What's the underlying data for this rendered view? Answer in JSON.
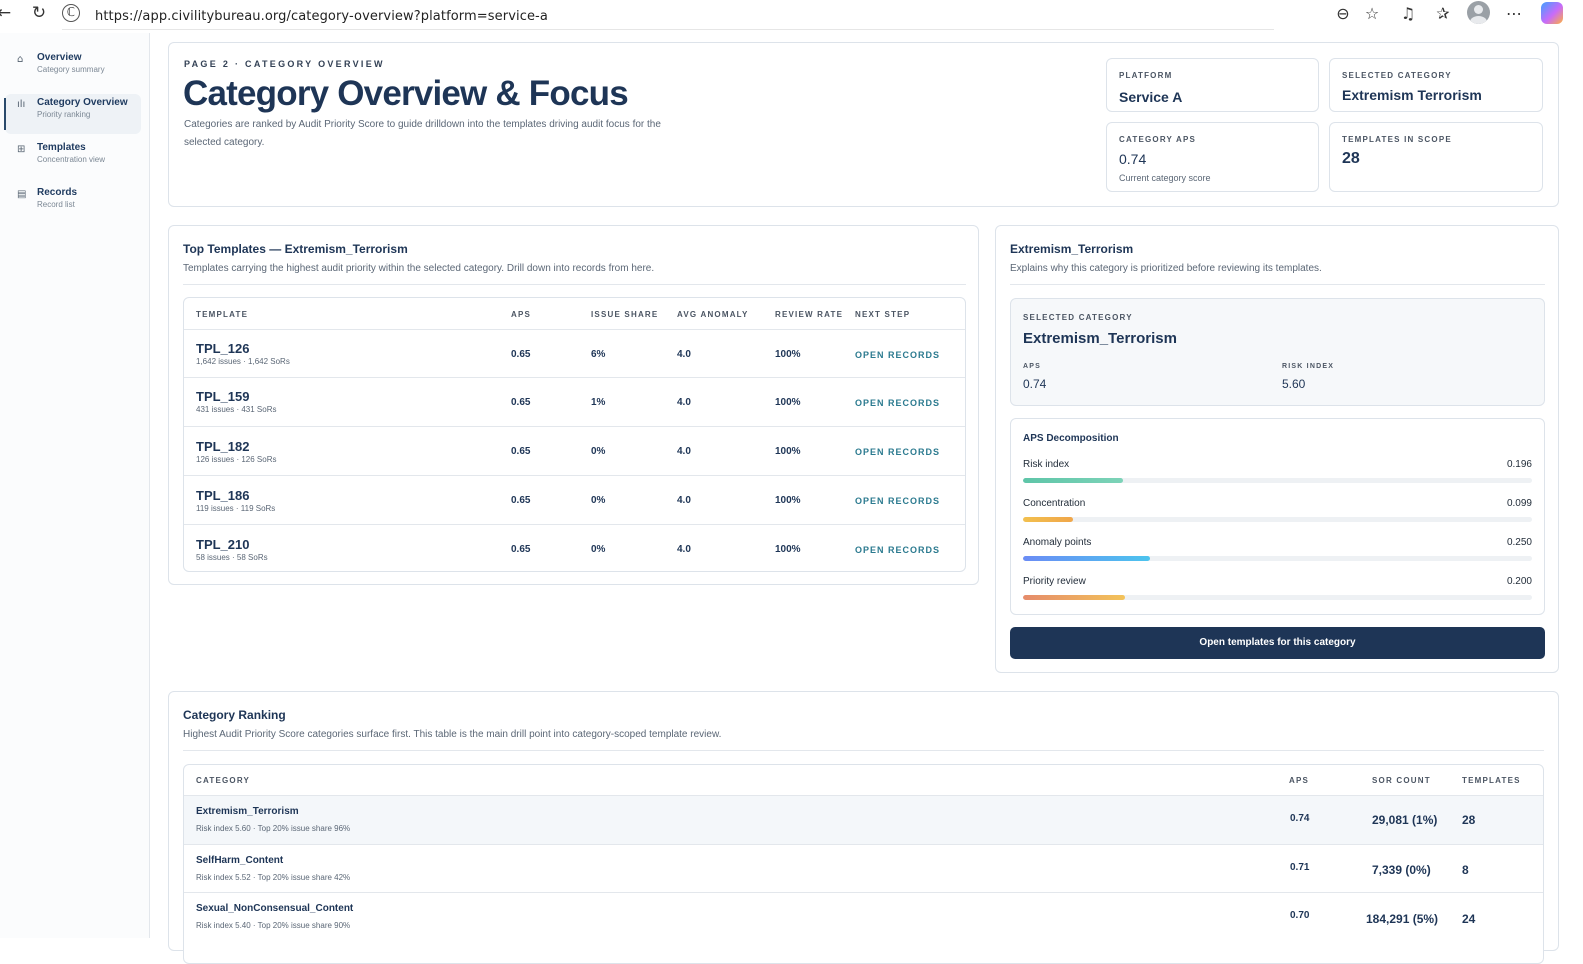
{
  "browser": {
    "url": "https://app.civilitybureau.org/category-overview?platform=service-a"
  },
  "sidebar": {
    "items": [
      {
        "icon": "home-icon",
        "label": "Overview",
        "sub": "Category summary",
        "active": false
      },
      {
        "icon": "bar-chart-icon",
        "label": "Category Overview",
        "sub": "Priority ranking",
        "active": true
      },
      {
        "icon": "grid-icon",
        "label": "Templates",
        "sub": "Concentration view",
        "active": false
      },
      {
        "icon": "list-icon",
        "label": "Records",
        "sub": "Record list",
        "active": false
      }
    ]
  },
  "header": {
    "eyebrow": "PAGE 2 · CATEGORY OVERVIEW",
    "title": "Category Overview & Focus",
    "description": "Categories are ranked by Audit Priority Score to guide drilldown into the templates driving audit focus for the selected category.",
    "stats": {
      "platform_label": "PLATFORM",
      "platform_value": "Service A",
      "selected_label": "SELECTED CATEGORY",
      "selected_value": "Extremism Terrorism",
      "aps_label": "CATEGORY APS",
      "aps_value": "0.74",
      "aps_sub": "Current category score",
      "templates_label": "TEMPLATES IN SCOPE",
      "templates_value": "28"
    }
  },
  "top_templates": {
    "title": "Top Templates — Extremism_Terrorism",
    "description": "Templates carrying the highest audit priority within the selected category. Drill down into records from here.",
    "columns": [
      "TEMPLATE",
      "APS",
      "ISSUE SHARE",
      "AVG ANOMALY",
      "REVIEW RATE",
      "NEXT STEP"
    ],
    "rows": [
      {
        "name": "TPL_126",
        "sub": "1,642 issues · 1,642 SoRs",
        "aps": "0.65",
        "share": "6%",
        "anomaly": "4.0",
        "review": "100%",
        "action": "OPEN RECORDS"
      },
      {
        "name": "TPL_159",
        "sub": "431 issues · 431 SoRs",
        "aps": "0.65",
        "share": "1%",
        "anomaly": "4.0",
        "review": "100%",
        "action": "OPEN RECORDS"
      },
      {
        "name": "TPL_182",
        "sub": "126 issues · 126 SoRs",
        "aps": "0.65",
        "share": "0%",
        "anomaly": "4.0",
        "review": "100%",
        "action": "OPEN RECORDS"
      },
      {
        "name": "TPL_186",
        "sub": "119 issues · 119 SoRs",
        "aps": "0.65",
        "share": "0%",
        "anomaly": "4.0",
        "review": "100%",
        "action": "OPEN RECORDS"
      },
      {
        "name": "TPL_210",
        "sub": "58 issues · 58 SoRs",
        "aps": "0.65",
        "share": "0%",
        "anomaly": "4.0",
        "review": "100%",
        "action": "OPEN RECORDS"
      }
    ]
  },
  "category_detail": {
    "title": "Extremism_Terrorism",
    "description": "Explains why this category is prioritized before reviewing its templates.",
    "selected_label": "SELECTED CATEGORY",
    "selected_name": "Extremism_Terrorism",
    "aps_label": "APS",
    "aps_value": "0.74",
    "risk_label": "RISK INDEX",
    "risk_value": "5.60",
    "decomp_title": "APS Decomposition",
    "components": [
      {
        "label": "Risk index",
        "value": "0.196",
        "fraction": 0.196,
        "color_from": "#5ec5a8",
        "color_to": "#7dd3b8"
      },
      {
        "label": "Concentration",
        "value": "0.099",
        "fraction": 0.099,
        "color_from": "#f2c04e",
        "color_to": "#f0a64a"
      },
      {
        "label": "Anomaly points",
        "value": "0.250",
        "fraction": 0.25,
        "color_from": "#6b8cf5",
        "color_to": "#4cc4ee"
      },
      {
        "label": "Priority review",
        "value": "0.200",
        "fraction": 0.2,
        "color_from": "#e58b6b",
        "color_to": "#f3c35a"
      }
    ],
    "cta": "Open templates for this category"
  },
  "ranking": {
    "title": "Category Ranking",
    "description": "Highest Audit Priority Score categories surface first. This table is the main drill point into category-scoped template review.",
    "columns": [
      "CATEGORY",
      "APS",
      "SOR COUNT",
      "TEMPLATES"
    ],
    "rows": [
      {
        "name": "Extremism_Terrorism",
        "sub": "Risk index 5.60 · Top 20% issue share 96%",
        "aps": "0.74",
        "sor": "29,081 (1%)",
        "templates": "28"
      },
      {
        "name": "SelfHarm_Content",
        "sub": "Risk index 5.52 · Top 20% issue share 42%",
        "aps": "0.71",
        "sor": "7,339 (0%)",
        "templates": "8"
      },
      {
        "name": "Sexual_NonConsensual_Content",
        "sub": "Risk index 5.40 · Top 20% issue share 90%",
        "aps": "0.70",
        "sor": "184,291 (5%)",
        "templates": "24"
      }
    ]
  },
  "colors": {
    "primary": "#1e3556",
    "link": "#2b7a8f"
  }
}
